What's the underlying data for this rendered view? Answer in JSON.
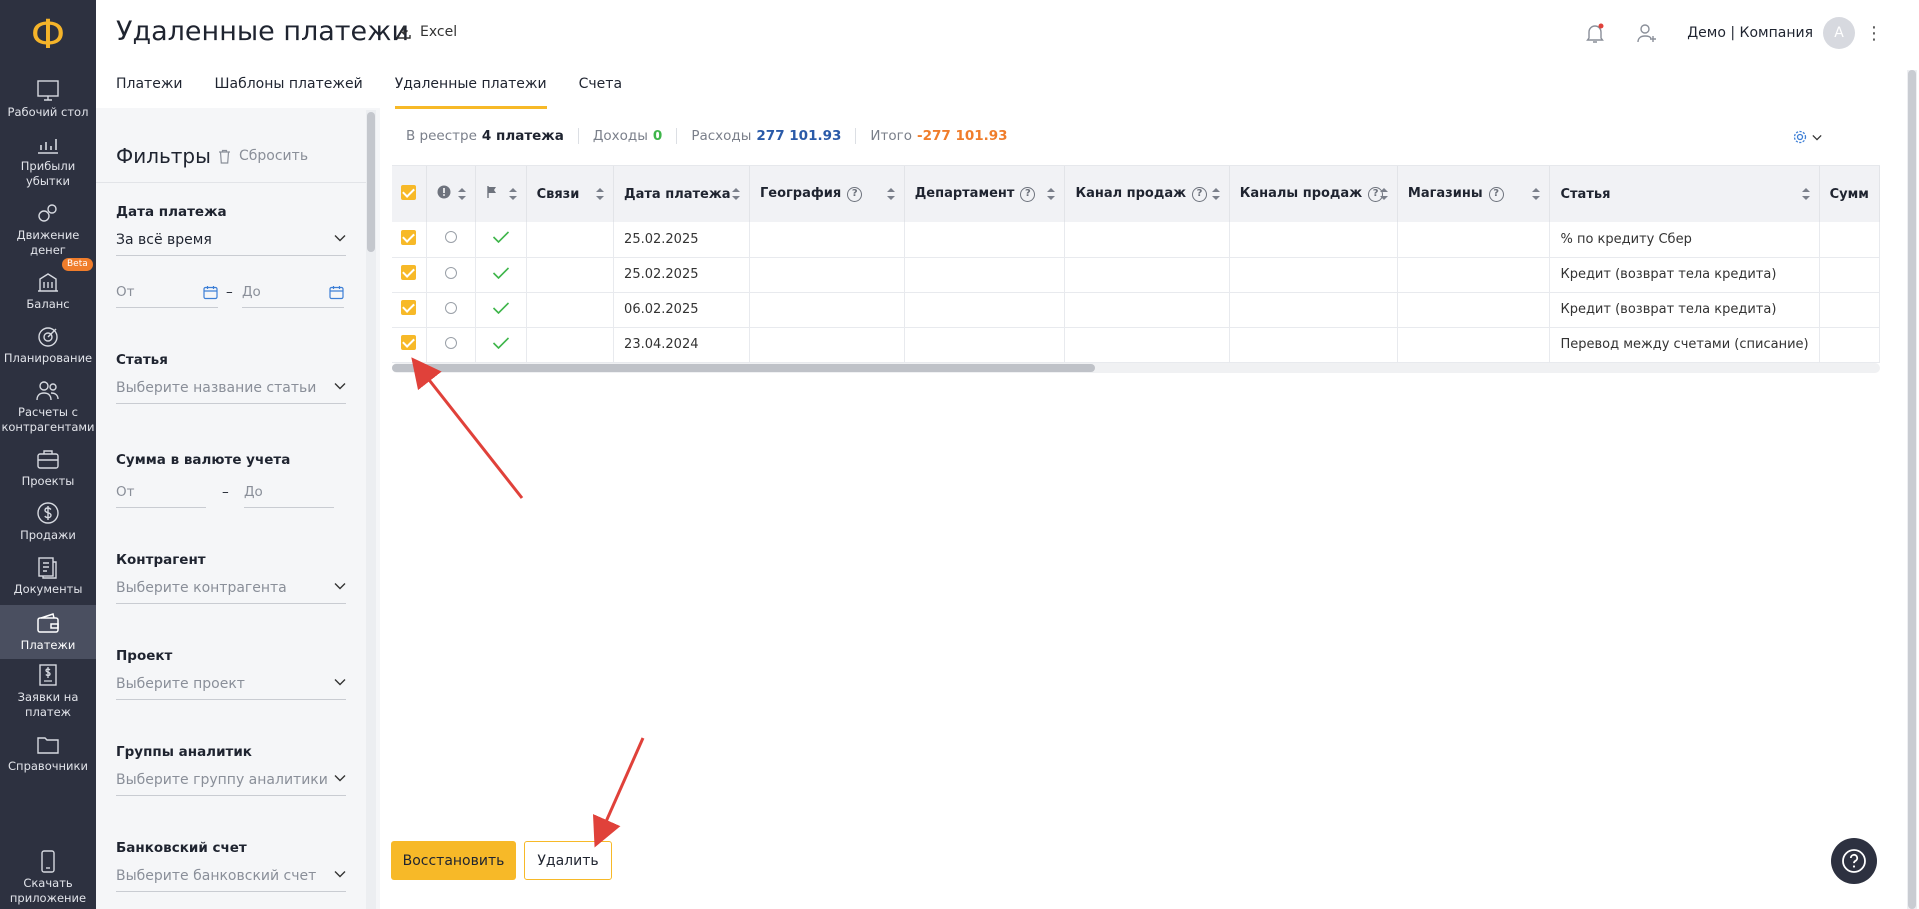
{
  "app": {
    "logo_glyph": "Ф",
    "page_title": "Удаленные платежи",
    "excel_label": "Excel",
    "company": "Демо | Компания",
    "avatar_letter": "А"
  },
  "nav": [
    {
      "label": "Рабочий стол",
      "icon": "desktop-icon"
    },
    {
      "label": "Прибыли убытки",
      "icon": "profit-chart-icon"
    },
    {
      "label": "Движение денег",
      "icon": "money-flow-icon"
    },
    {
      "label": "Баланс",
      "icon": "balance-icon",
      "badge": "Beta"
    },
    {
      "label": "Планирование",
      "icon": "target-icon"
    },
    {
      "label": "Расчеты с контрагентами",
      "icon": "contractors-icon"
    },
    {
      "label": "Проекты",
      "icon": "briefcase-icon"
    },
    {
      "label": "Продажи",
      "icon": "dollar-icon"
    },
    {
      "label": "Документы",
      "icon": "documents-icon"
    },
    {
      "label": "Платежи",
      "icon": "wallet-icon",
      "active": true
    },
    {
      "label": "Заявки на платеж",
      "icon": "request-icon"
    },
    {
      "label": "Справочники",
      "icon": "folder-icon"
    },
    {
      "label": "Скачать приложение",
      "icon": "phone-icon"
    }
  ],
  "tabs": [
    {
      "label": "Платежи"
    },
    {
      "label": "Шаблоны платежей"
    },
    {
      "label": "Удаленные платежи",
      "active": true
    },
    {
      "label": "Счета"
    }
  ],
  "filters": {
    "title": "Фильтры",
    "reset_label": "Сбросить",
    "date_label": "Дата платежа",
    "date_value": "За всё время",
    "from_placeholder": "От",
    "to_placeholder": "До",
    "dash": "–",
    "article_label": "Статья",
    "article_placeholder": "Выберите название статьи",
    "sum_label": "Сумма в валюте учета",
    "contractor_label": "Контрагент",
    "contractor_placeholder": "Выберите контрагента",
    "project_label": "Проект",
    "project_placeholder": "Выберите проект",
    "groups_label": "Группы аналитик",
    "groups_placeholder": "Выберите группу аналитики",
    "bank_label": "Банковский счет",
    "bank_placeholder": "Выберите банковский счет"
  },
  "summary": {
    "registry_label": "В реестре",
    "registry_count": "4 платежа",
    "income_label": "Доходы",
    "income_value": "0",
    "expense_label": "Расходы",
    "expense_value": "277 101.93",
    "total_label": "Итого",
    "total_value": "-277 101.93"
  },
  "table": {
    "columns": [
      {
        "label": "Связи"
      },
      {
        "label": "Дата платежа"
      },
      {
        "label": "География",
        "help": "?"
      },
      {
        "label": "Департамент",
        "help": "?"
      },
      {
        "label": "Канал продаж",
        "help": "?"
      },
      {
        "label": "Каналы продаж",
        "help": "?"
      },
      {
        "label": "Магазины",
        "help": "?"
      },
      {
        "label": "Статья"
      },
      {
        "label": "Сумм"
      }
    ],
    "rows": [
      {
        "date": "25.02.2025",
        "article": "% по кредиту Сбер"
      },
      {
        "date": "25.02.2025",
        "article": "Кредит (возврат тела кредита)"
      },
      {
        "date": "06.02.2025",
        "article": "Кредит (возврат тела кредита)"
      },
      {
        "date": "23.04.2024",
        "article": "Перевод между счетами (списание)"
      }
    ]
  },
  "buttons": {
    "restore": "Восстановить",
    "delete": "Удалить"
  },
  "colors": {
    "accent": "#f7b928",
    "sidebar": "#2d3140",
    "income": "#3eb54a",
    "expense": "#2a5aa8",
    "total": "#f07d2b",
    "annotation_arrow": "#e0413a"
  }
}
